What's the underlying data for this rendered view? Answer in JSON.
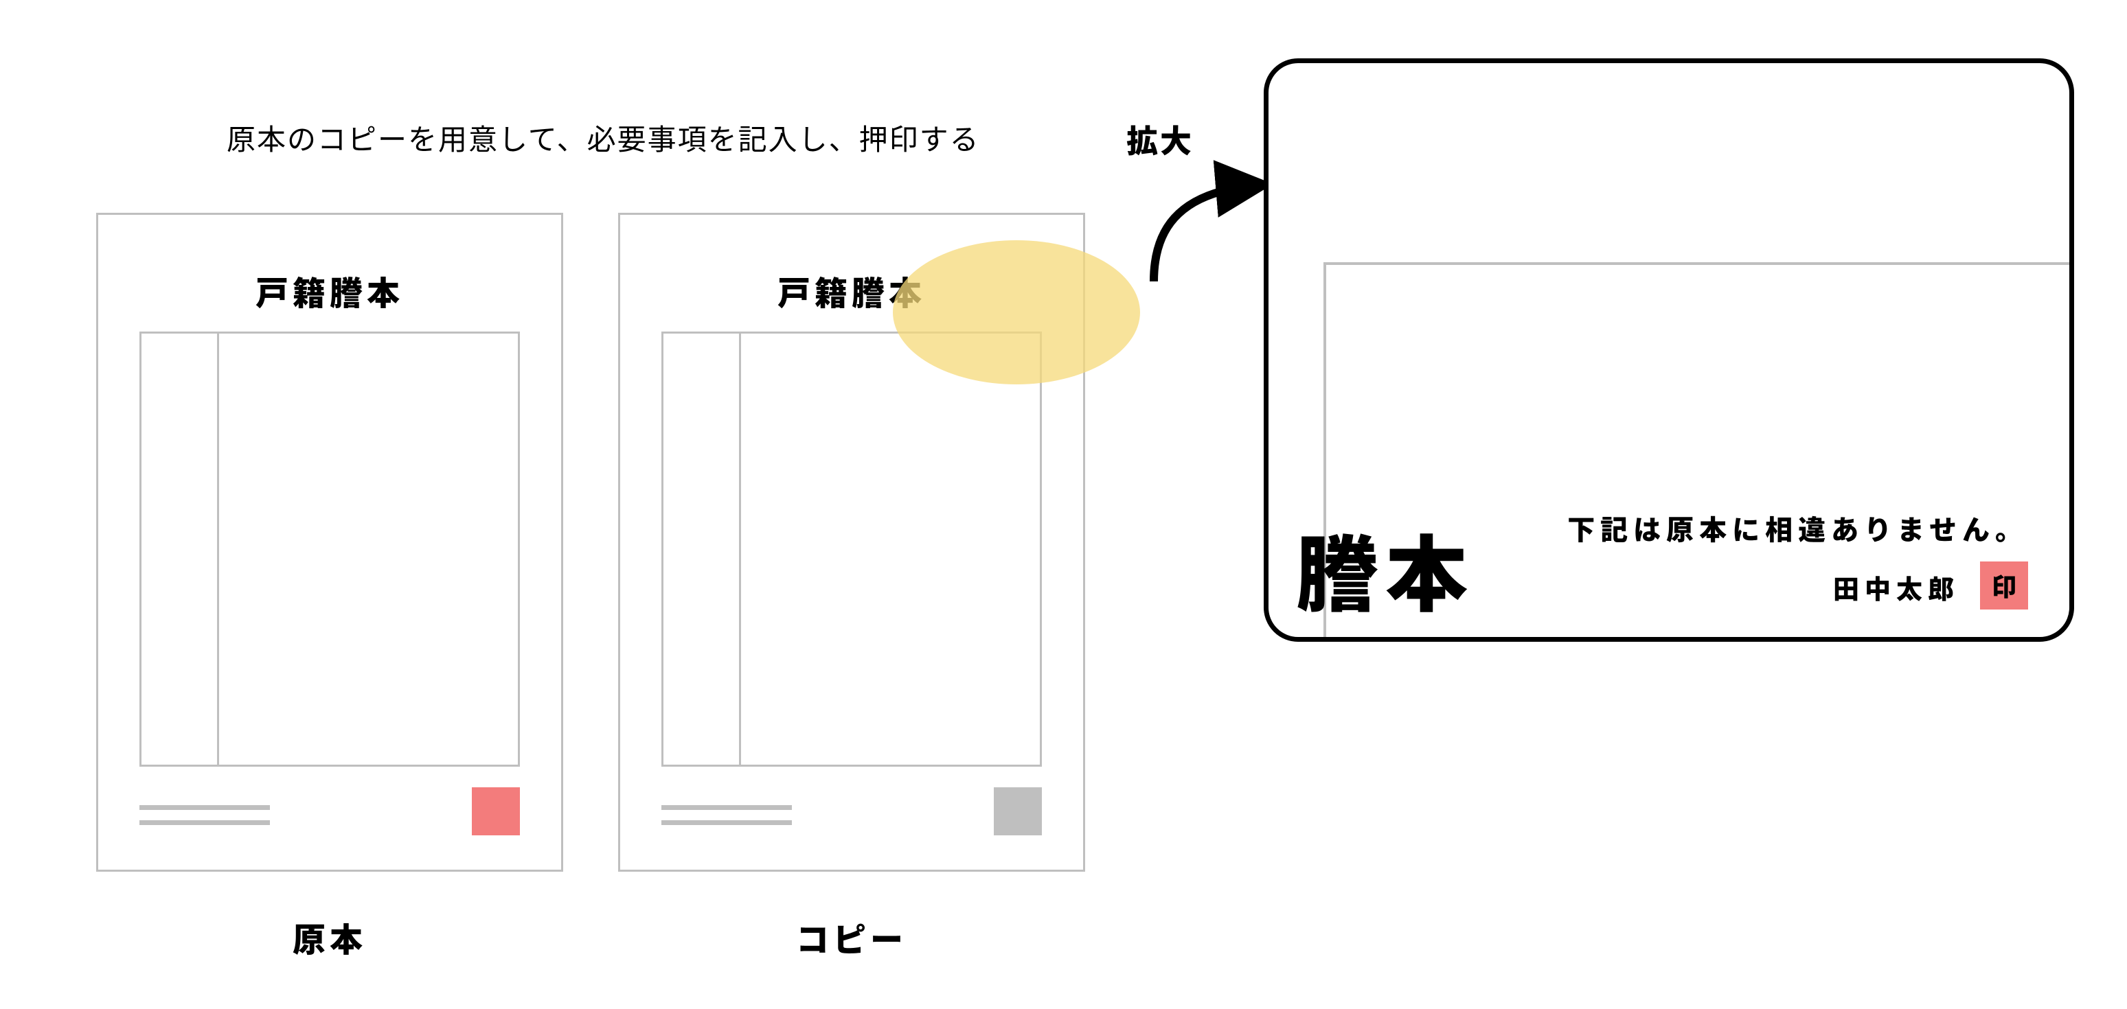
{
  "instruction": "原本のコピーを用意して、必要事項を記入し、押印する",
  "documents": {
    "original": {
      "title": "戸籍謄本",
      "caption": "原本"
    },
    "copy": {
      "title": "戸籍謄本",
      "caption": "コピー"
    }
  },
  "arrow_label": "拡大",
  "zoom": {
    "title_fragment": "謄本",
    "statement": "下記は原本に相違ありません。",
    "name": "田中太郎",
    "seal_char": "印"
  },
  "colors": {
    "seal_red": "#f37c7c",
    "line_gray": "#bfbfbf",
    "highlight": "#f6d97a"
  }
}
